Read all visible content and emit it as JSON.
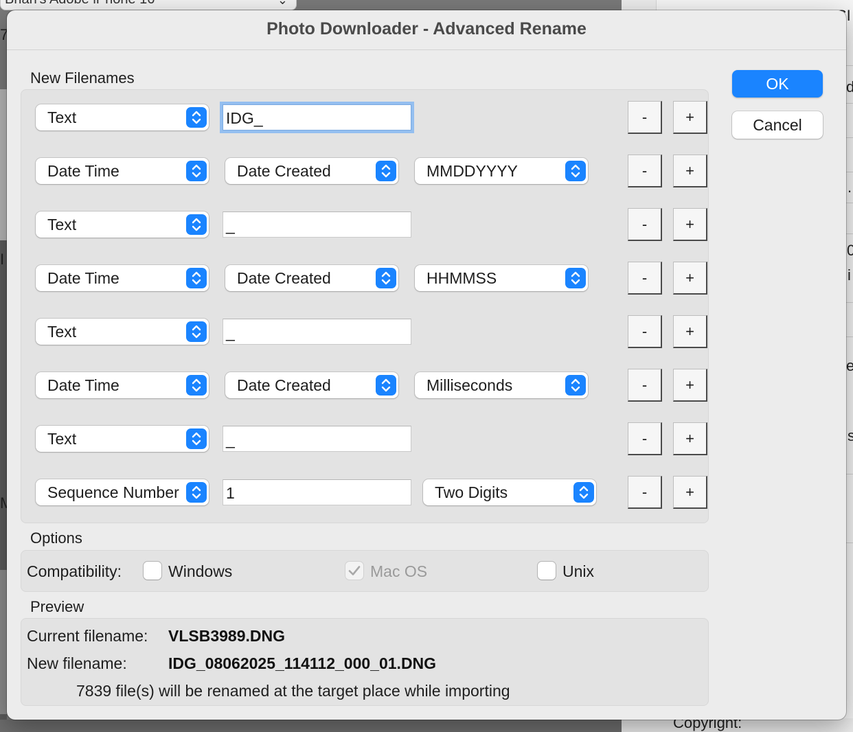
{
  "background": {
    "top_bar_text": "Brian's Adobe iPhone 16",
    "copyright_label": "Copyright:",
    "edge_chars": [
      "7",
      "SI",
      "d",
      ".",
      "0",
      "i",
      "e",
      "s",
      "I",
      "M"
    ]
  },
  "dialog": {
    "title": "Photo Downloader - Advanced Rename",
    "ok_label": "OK",
    "cancel_label": "Cancel"
  },
  "new_filenames": {
    "label": "New Filenames",
    "rows": [
      {
        "type": "Text",
        "text_value": "IDG_",
        "focused": true
      },
      {
        "type": "Date Time",
        "source": "Date Created",
        "format": "MMDDYYYY"
      },
      {
        "type": "Text",
        "text_value": "_"
      },
      {
        "type": "Date Time",
        "source": "Date Created",
        "format": "HHMMSS"
      },
      {
        "type": "Text",
        "text_value": "_"
      },
      {
        "type": "Date Time",
        "source": "Date Created",
        "format": "Milliseconds"
      },
      {
        "type": "Text",
        "text_value": "_"
      },
      {
        "type": "Sequence Number",
        "text_value": "1",
        "format": "Two Digits"
      }
    ],
    "remove_label": "-",
    "add_label": "+"
  },
  "options": {
    "label": "Options",
    "compatibility_label": "Compatibility:",
    "windows": {
      "label": "Windows",
      "checked": false,
      "enabled": true
    },
    "macos": {
      "label": "Mac OS",
      "checked": true,
      "enabled": false
    },
    "unix": {
      "label": "Unix",
      "checked": false,
      "enabled": true
    }
  },
  "preview": {
    "label": "Preview",
    "current_label": "Current filename:",
    "current_value": "VLSB3989.DNG",
    "new_label": "New filename:",
    "new_value": "IDG_08062025_114112_000_01.DNG",
    "summary": "7839 file(s) will be renamed at the target place while importing"
  },
  "colors": {
    "accent": "#1a84ff",
    "dialog_bg": "#ececec",
    "group_bg": "#e3e3e3"
  }
}
